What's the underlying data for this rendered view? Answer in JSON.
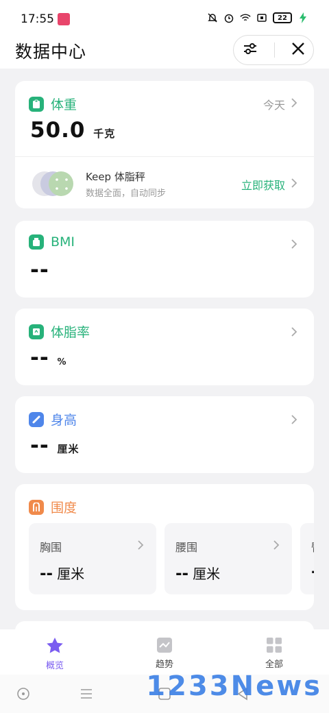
{
  "status": {
    "time": "17:55",
    "battery": "22"
  },
  "header": {
    "title": "数据中心"
  },
  "weight": {
    "title": "体重",
    "date": "今天",
    "value": "50.0",
    "unit": "千克",
    "keep_title": "Keep 体脂秤",
    "keep_sub": "数据全面，自动同步",
    "keep_link": "立即获取",
    "color": "#27b27a"
  },
  "bmi": {
    "title": "BMI",
    "value": "--",
    "color": "#27b27a"
  },
  "bodyfat": {
    "title": "体脂率",
    "value": "--",
    "unit": "%",
    "color": "#27b27a"
  },
  "height": {
    "title": "身高",
    "value": "--",
    "unit": "厘米",
    "color": "#4f86ea"
  },
  "girth": {
    "title": "围度",
    "color": "#f08a4b",
    "items": [
      {
        "label": "胸围",
        "value": "--",
        "unit": "厘米"
      },
      {
        "label": "腰围",
        "value": "--",
        "unit": "厘米"
      },
      {
        "label": "臀",
        "value": "-",
        "unit": ""
      }
    ]
  },
  "tabs": [
    {
      "label": "概览",
      "icon": "star-icon"
    },
    {
      "label": "趋势",
      "icon": "trend-icon"
    },
    {
      "label": "全部",
      "icon": "grid-icon"
    }
  ],
  "watermark": "1233News"
}
